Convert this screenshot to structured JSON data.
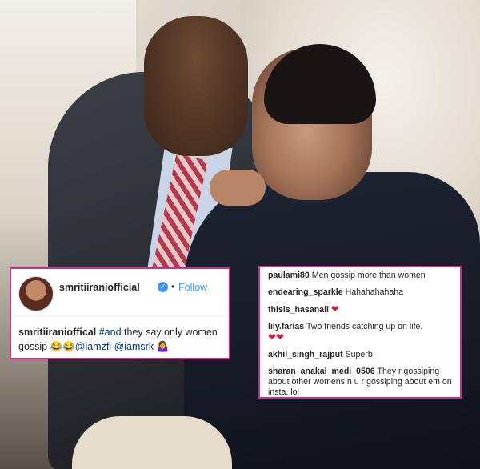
{
  "post": {
    "username": "smritiiraniofficial",
    "verified_icon": "verified-badge-icon",
    "separator": "•",
    "follow_label": "Follow",
    "caption_user": "smritiiranioffical",
    "caption_hashtag": "#and",
    "caption_text": " they say only women gossip ",
    "caption_emoji1": "😂😂",
    "caption_mention1": "@iamzfi",
    "caption_mention2": "@iamsrk",
    "caption_emoji2": "🤷‍♀️"
  },
  "comments": [
    {
      "user": "paulami80",
      "text": "Men gossip more than women"
    },
    {
      "user": "endearing_sparkle",
      "text": "Hahahahahaha"
    },
    {
      "user": "thisis_hasanali",
      "text": "",
      "emoji": "❤"
    },
    {
      "user": "lily.farias",
      "text": "Two friends catching up on life.",
      "emoji": "❤❤"
    },
    {
      "user": "akhil_singh_rajput",
      "text": "Superb"
    },
    {
      "user": "sharan_anakal_medi_0506",
      "text": "They r gossiping about other womens n u r gossiping about em on insta, lol"
    }
  ],
  "colors": {
    "highlight_border": "#cf2c8a",
    "link": "#3897f0",
    "heart": "#d6203a"
  }
}
